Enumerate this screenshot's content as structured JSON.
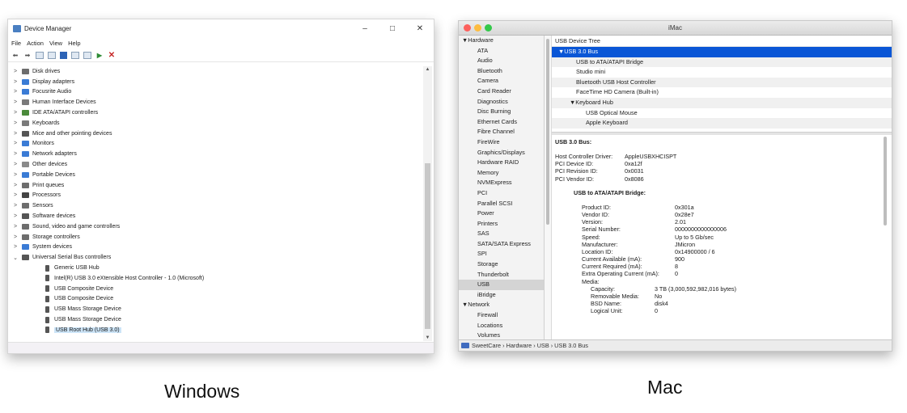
{
  "windows": {
    "title": "Device Manager",
    "controls": [
      "–",
      "□",
      "✕"
    ],
    "menu": [
      "File",
      "Action",
      "View",
      "Help"
    ],
    "toolbar_icons": [
      "back-arrow-icon",
      "forward-arrow-icon",
      "properties-icon",
      "tree-icon",
      "help-icon",
      "list-icon",
      "monitor-icon",
      "enable-device-icon",
      "uninstall-x-icon"
    ],
    "tree": [
      {
        "label": "Disk drives",
        "chevron": ">",
        "indent": 0,
        "color": "#6d6d6d"
      },
      {
        "label": "Display adapters",
        "chevron": ">",
        "indent": 0,
        "color": "#3a7bd5"
      },
      {
        "label": "Focusrite Audio",
        "chevron": ">",
        "indent": 0,
        "color": "#3a7bd5"
      },
      {
        "label": "Human Interface Devices",
        "chevron": ">",
        "indent": 0,
        "color": "#7a7a7a"
      },
      {
        "label": "IDE ATA/ATAPI controllers",
        "chevron": ">",
        "indent": 0,
        "color": "#4a8a3a"
      },
      {
        "label": "Keyboards",
        "chevron": ">",
        "indent": 0,
        "color": "#7a7a7a"
      },
      {
        "label": "Mice and other pointing devices",
        "chevron": ">",
        "indent": 0,
        "color": "#555555"
      },
      {
        "label": "Monitors",
        "chevron": ">",
        "indent": 0,
        "color": "#3a7bd5"
      },
      {
        "label": "Network adapters",
        "chevron": ">",
        "indent": 0,
        "color": "#3a7bd5"
      },
      {
        "label": "Other devices",
        "chevron": ">",
        "indent": 0,
        "color": "#8a8a8a"
      },
      {
        "label": "Portable Devices",
        "chevron": ">",
        "indent": 0,
        "color": "#3a7bd5"
      },
      {
        "label": "Print queues",
        "chevron": ">",
        "indent": 0,
        "color": "#6d6d6d"
      },
      {
        "label": "Processors",
        "chevron": ">",
        "indent": 0,
        "color": "#444444"
      },
      {
        "label": "Sensors",
        "chevron": ">",
        "indent": 0,
        "color": "#6d6d6d"
      },
      {
        "label": "Software devices",
        "chevron": ">",
        "indent": 0,
        "color": "#555555"
      },
      {
        "label": "Sound, video and game controllers",
        "chevron": ">",
        "indent": 0,
        "color": "#6d6d6d"
      },
      {
        "label": "Storage controllers",
        "chevron": ">",
        "indent": 0,
        "color": "#6d6d6d"
      },
      {
        "label": "System devices",
        "chevron": ">",
        "indent": 0,
        "color": "#3a7bd5"
      },
      {
        "label": "Universal Serial Bus controllers",
        "chevron": "⌄",
        "indent": 0,
        "color": "#555555"
      },
      {
        "label": "Generic USB Hub",
        "chevron": "",
        "indent": 1,
        "color": "#555555"
      },
      {
        "label": "Intel(R) USB 3.0 eXtensible Host Controller - 1.0 (Microsoft)",
        "chevron": "",
        "indent": 1,
        "color": "#555555"
      },
      {
        "label": "USB Composite Device",
        "chevron": "",
        "indent": 1,
        "color": "#555555"
      },
      {
        "label": "USB Composite Device",
        "chevron": "",
        "indent": 1,
        "color": "#555555"
      },
      {
        "label": "USB Mass Storage Device",
        "chevron": "",
        "indent": 1,
        "color": "#555555"
      },
      {
        "label": "USB Mass Storage Device",
        "chevron": "",
        "indent": 1,
        "color": "#555555"
      },
      {
        "label": "USB Root Hub (USB 3.0)",
        "chevron": "",
        "indent": 1,
        "color": "#555555"
      }
    ],
    "caption": "Windows"
  },
  "mac": {
    "title": "iMac",
    "dot_colors": [
      "#fc605c",
      "#fdbc40",
      "#34c84a"
    ],
    "sidebar": [
      {
        "label": "▼Hardware",
        "hdr": true
      },
      {
        "label": "ATA"
      },
      {
        "label": "Audio"
      },
      {
        "label": "Bluetooth"
      },
      {
        "label": "Camera"
      },
      {
        "label": "Card Reader"
      },
      {
        "label": "Diagnostics"
      },
      {
        "label": "Disc Burning"
      },
      {
        "label": "Ethernet Cards"
      },
      {
        "label": "Fibre Channel"
      },
      {
        "label": "FireWire"
      },
      {
        "label": "Graphics/Displays"
      },
      {
        "label": "Hardware RAID"
      },
      {
        "label": "Memory"
      },
      {
        "label": "NVMExpress"
      },
      {
        "label": "PCI"
      },
      {
        "label": "Parallel SCSI"
      },
      {
        "label": "Power"
      },
      {
        "label": "Printers"
      },
      {
        "label": "SAS"
      },
      {
        "label": "SATA/SATA Express"
      },
      {
        "label": "SPI"
      },
      {
        "label": "Storage"
      },
      {
        "label": "Thunderbolt"
      },
      {
        "label": "USB",
        "sel": true
      },
      {
        "label": "iBridge"
      },
      {
        "label": "▼Network",
        "hdr": true
      },
      {
        "label": "Firewall"
      },
      {
        "label": "Locations"
      },
      {
        "label": "Volumes"
      }
    ],
    "tree_header": "USB Device Tree",
    "tree": [
      {
        "label": "▼USB 3.0 Bus",
        "indent": 8,
        "sel": true
      },
      {
        "label": "USB to ATA/ATAPI Bridge",
        "indent": 30
      },
      {
        "label": "Studio mini",
        "indent": 30
      },
      {
        "label": "Bluetooth USB Host Controller",
        "indent": 30
      },
      {
        "label": "FaceTime HD Camera (Built-in)",
        "indent": 30
      },
      {
        "label": "▼Keyboard Hub",
        "indent": 22
      },
      {
        "label": "USB Optical Mouse",
        "indent": 42
      },
      {
        "label": "Apple Keyboard",
        "indent": 42
      }
    ],
    "detail_title": "USB 3.0 Bus:",
    "host_info": [
      {
        "k": "Host Controller Driver:",
        "v": "AppleUSBXHCISPT"
      },
      {
        "k": "PCI Device ID:",
        "v": "0xa12f"
      },
      {
        "k": "PCI Revision ID:",
        "v": "0x0031"
      },
      {
        "k": "PCI Vendor ID:",
        "v": "0x8086"
      }
    ],
    "bridge_title": "USB to ATA/ATAPI Bridge:",
    "bridge_info": [
      {
        "k": "Product ID:",
        "v": "0x301a"
      },
      {
        "k": "Vendor ID:",
        "v": "0x28e7"
      },
      {
        "k": "Version:",
        "v": "2.01"
      },
      {
        "k": "Serial Number:",
        "v": "0000000000000006"
      },
      {
        "k": "Speed:",
        "v": "Up to 5 Gb/sec"
      },
      {
        "k": "Manufacturer:",
        "v": "JMicron"
      },
      {
        "k": "Location ID:",
        "v": "0x14900000 / 6"
      },
      {
        "k": "Current Available (mA):",
        "v": "900"
      },
      {
        "k": "Current Required (mA):",
        "v": "8"
      },
      {
        "k": "Extra Operating Current (mA):",
        "v": "0"
      },
      {
        "k": "Media:",
        "v": ""
      }
    ],
    "media_info": [
      {
        "k": "Capacity:",
        "v": "3 TB (3,000,592,982,016 bytes)"
      },
      {
        "k": "Removable Media:",
        "v": "No"
      },
      {
        "k": "BSD Name:",
        "v": "disk4"
      },
      {
        "k": "Logical Unit:",
        "v": "0"
      }
    ],
    "path": "SweetCare › Hardware › USB › USB 3.0 Bus",
    "caption": "Mac"
  }
}
